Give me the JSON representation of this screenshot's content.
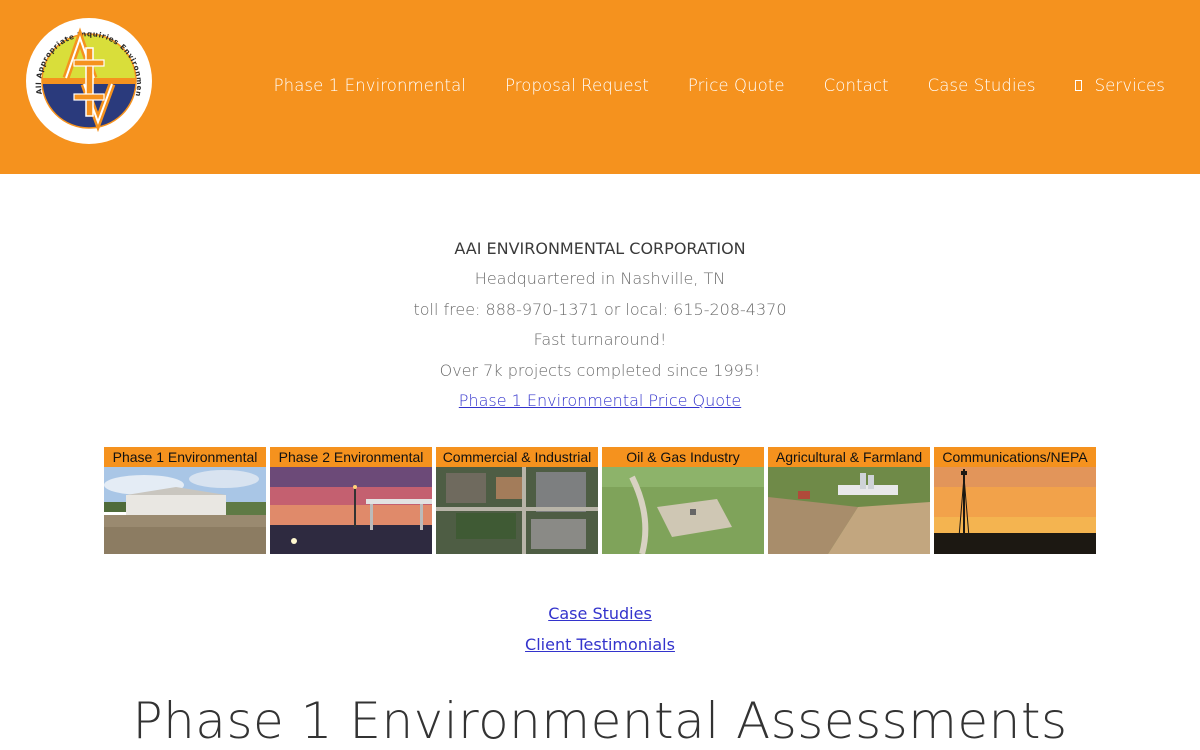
{
  "header": {
    "logo": {
      "ring_text": "All Appropriate Inquiries Environmental Corporation",
      "letters": "AAI"
    },
    "nav": [
      {
        "label": "Phase 1 Environmental"
      },
      {
        "label": "Proposal Request"
      },
      {
        "label": "Price Quote"
      },
      {
        "label": "Contact"
      },
      {
        "label": "Case Studies"
      },
      {
        "label": "Services",
        "icon": "mobile-icon"
      }
    ]
  },
  "intro": {
    "company": "AAI ENVIRONMENTAL CORPORATION",
    "headquarters": "Headquartered in Nashville, TN",
    "phone": "toll free: 888-970-1371 or local: 615-208-4370",
    "turnaround": "Fast turnaround!",
    "projects": "Over 7k projects completed since 1995!",
    "quote_link": "Phase 1 Environmental Price Quote"
  },
  "tiles": [
    {
      "label": "Phase 1 Environmental"
    },
    {
      "label": "Phase 2 Environmental"
    },
    {
      "label": "Commercial & Industrial"
    },
    {
      "label": "Oil & Gas Industry"
    },
    {
      "label": "Agricultural & Farmland"
    },
    {
      "label": "Communications/NEPA"
    }
  ],
  "links": {
    "case_studies": "Case Studies",
    "testimonials": "Client Testimonials"
  },
  "page_title": "Phase 1 Environmental Assessments",
  "colors": {
    "brand_orange": "#f5921e",
    "link_blue": "#3333cc",
    "logo_navy": "#2a3a7c",
    "logo_yellow": "#d9de3a"
  }
}
